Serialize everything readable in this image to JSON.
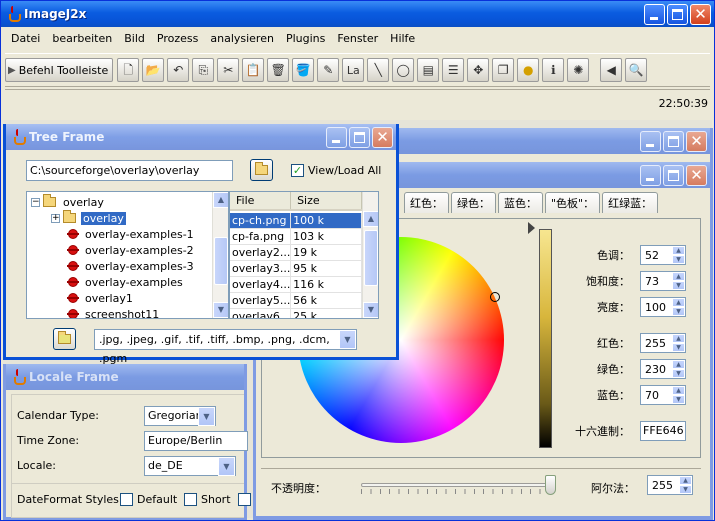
{
  "main_window": {
    "title": "ImageJ2x"
  },
  "menu": [
    "Datei",
    "bearbeiten",
    "Bild",
    "Prozess",
    "analysieren",
    "Plugins",
    "Fenster",
    "Hilfe"
  ],
  "toolbar": {
    "command_label": "Befehl Toolleiste",
    "la_label": "La"
  },
  "status": {
    "clock": "22:50:39"
  },
  "tree_frame": {
    "title": "Tree Frame",
    "path": "C:\\sourceforge\\overlay\\overlay",
    "view_load_label": "View/Load All",
    "view_load_checked": true,
    "tree": [
      {
        "label": "overlay",
        "type": "folder",
        "expanded": true
      },
      {
        "label": "overlay",
        "type": "folder",
        "selected": true
      },
      {
        "label": "overlay-examples-1",
        "type": "file"
      },
      {
        "label": "overlay-examples-2",
        "type": "file"
      },
      {
        "label": "overlay-examples-3",
        "type": "file"
      },
      {
        "label": "overlay-examples",
        "type": "file"
      },
      {
        "label": "overlay1",
        "type": "file"
      },
      {
        "label": "screenshot11",
        "type": "file"
      }
    ],
    "file_columns": [
      "File",
      "Size"
    ],
    "files": [
      {
        "name": "cp-ch.png",
        "size": "100 k",
        "selected": true
      },
      {
        "name": "cp-fa.png",
        "size": "103 k"
      },
      {
        "name": "overlay2....",
        "size": "19 k"
      },
      {
        "name": "overlay3....",
        "size": "95 k"
      },
      {
        "name": "overlay4....",
        "size": "116 k"
      },
      {
        "name": "overlay5....",
        "size": "56 k"
      },
      {
        "name": "overlay6....",
        "size": "25 k"
      }
    ],
    "filter": ".jpg, .jpeg, .gif, .tif, .tiff, .bmp, .png, .dcm, .pgm"
  },
  "locale_frame": {
    "title": "Locale Frame",
    "calendar_type_label": "Calendar Type:",
    "calendar_type_value": "Gregorian",
    "time_zone_label": "Time Zone:",
    "time_zone_value": "Europe/Berlin",
    "locale_label": "Locale:",
    "locale_value": "de_DE",
    "dateformat_label": "DateFormat Styles:",
    "style_default": "Default",
    "style_short": "Short"
  },
  "color_chooser": {
    "tabs": [
      "红色：",
      "绿色：",
      "蓝色：",
      "\"色板\"：",
      "红绿蓝："
    ],
    "hue_label": "色调：",
    "hue": "52",
    "saturation_label": "饱和度：",
    "saturation": "73",
    "brightness_label": "亮度：",
    "brightness": "100",
    "red_label": "红色：",
    "red": "255",
    "green_label": "绿色：",
    "green": "230",
    "blue_label": "蓝色：",
    "blue": "70",
    "hex_label": "十六進制：",
    "hex": "FFE646",
    "opacity_label": "不透明度：",
    "alpha_label": "阿尔法：",
    "alpha": "255"
  },
  "colors": {
    "selection": "#316ac5",
    "titlebar_active": "#0a5ce0",
    "titlebar_inactive": "#7b9be3"
  }
}
